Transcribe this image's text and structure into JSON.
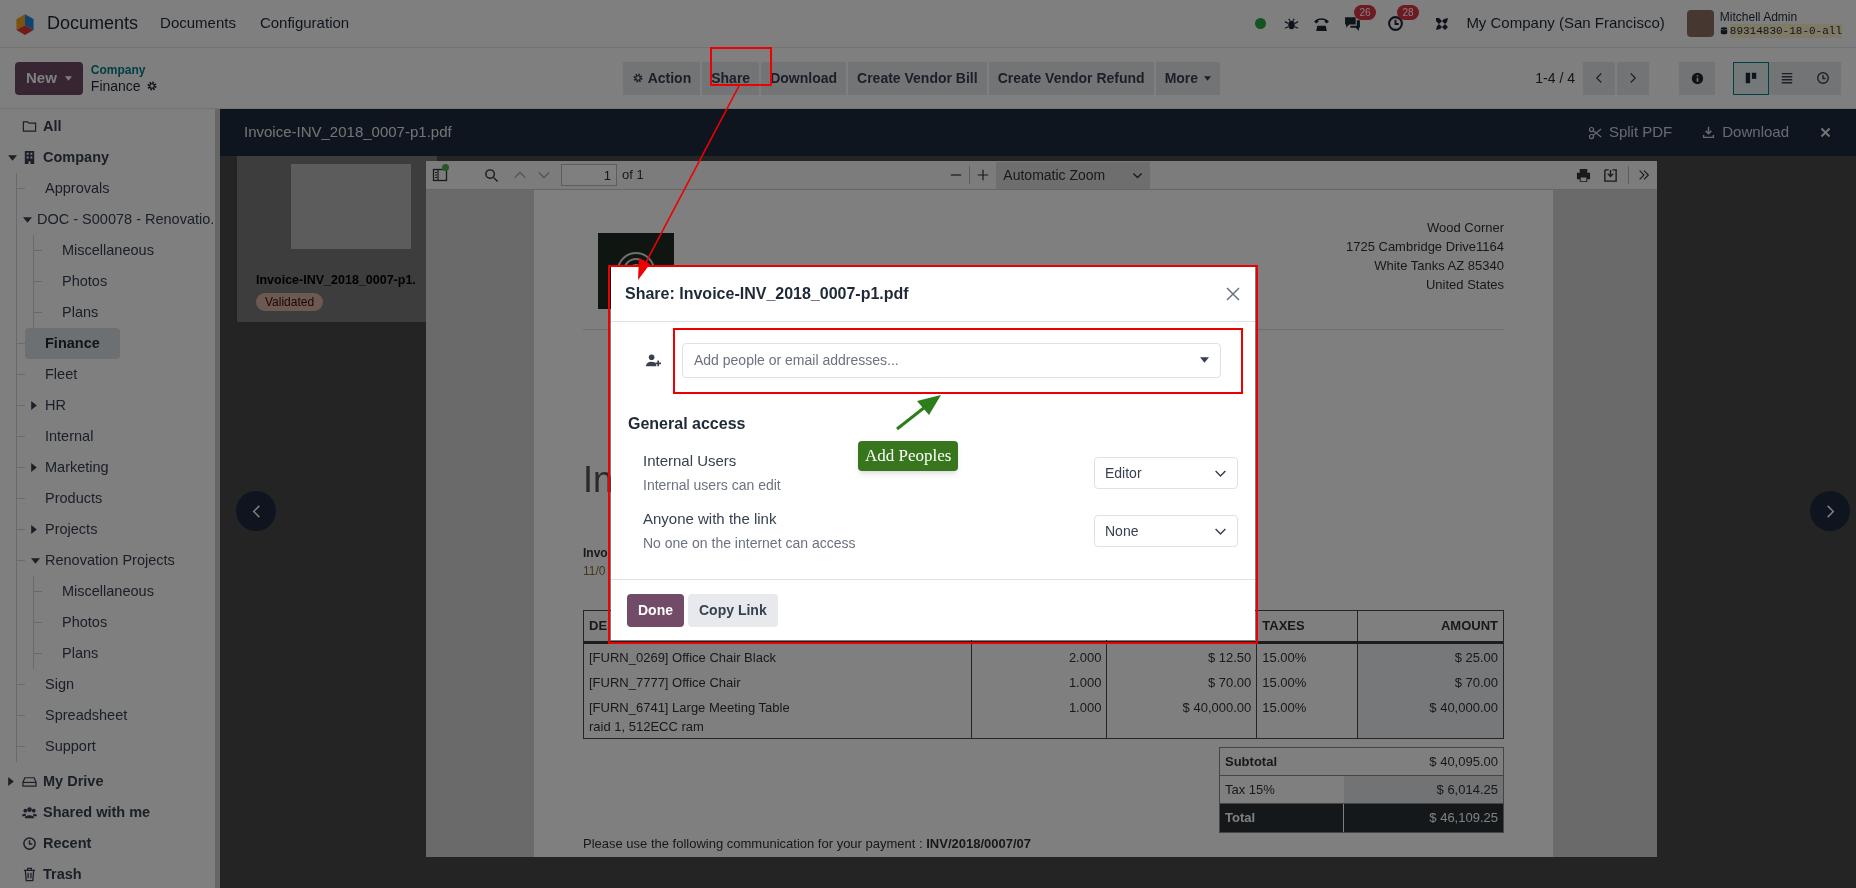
{
  "navbar": {
    "app": "Documents",
    "menu": [
      "Documents",
      "Configuration"
    ],
    "messages_badge": "26",
    "activities_badge": "28",
    "company": "My Company (San Francisco)",
    "user": {
      "name": "Mitchell Admin",
      "database": "89314830-18-0-all"
    }
  },
  "control_panel": {
    "new_button": "New",
    "breadcrumb": {
      "parent": "Company",
      "current": "Finance"
    },
    "actions": [
      {
        "label": "Action",
        "kind": "gear"
      },
      {
        "label": "Share",
        "kind": "plain"
      },
      {
        "label": "Download",
        "kind": "plain"
      },
      {
        "label": "Create Vendor Bill",
        "kind": "plain"
      },
      {
        "label": "Create Vendor Refund",
        "kind": "plain"
      },
      {
        "label": "More",
        "kind": "dropdown"
      }
    ],
    "pager": "1-4 / 4",
    "views": [
      {
        "kind": "kanban",
        "selected": true
      },
      {
        "kind": "list",
        "selected": false
      },
      {
        "kind": "activity",
        "selected": false
      }
    ]
  },
  "sidebar": {
    "items": [
      {
        "label": "All",
        "kind": "folder",
        "selected": false
      },
      {
        "label": "Company",
        "kind": "company",
        "selected": false,
        "expanded": true,
        "children": [
          {
            "label": "Approvals",
            "selected": false
          },
          {
            "label": "DOC - S00078 - Renovatio.",
            "selected": false,
            "expanded": true,
            "children": [
              {
                "label": "Miscellaneous",
                "selected": false
              },
              {
                "label": "Photos",
                "selected": false
              },
              {
                "label": "Plans",
                "selected": false
              }
            ]
          },
          {
            "label": "Finance",
            "selected": true
          },
          {
            "label": "Fleet",
            "selected": false
          },
          {
            "label": "HR",
            "selected": false,
            "expanded": false
          },
          {
            "label": "Internal",
            "selected": false
          },
          {
            "label": "Marketing",
            "selected": false,
            "expanded": false
          },
          {
            "label": "Products",
            "selected": false
          },
          {
            "label": "Projects",
            "selected": false,
            "expanded": false
          },
          {
            "label": "Renovation Projects",
            "selected": false,
            "expanded": true,
            "children": [
              {
                "label": "Miscellaneous",
                "selected": false
              },
              {
                "label": "Photos",
                "selected": false
              },
              {
                "label": "Plans",
                "selected": false
              }
            ]
          },
          {
            "label": "Sign",
            "selected": false
          },
          {
            "label": "Spreadsheet",
            "selected": false
          },
          {
            "label": "Support",
            "selected": false
          }
        ]
      },
      {
        "label": "My Drive",
        "kind": "drive",
        "selected": false,
        "expanded": false
      },
      {
        "label": "Shared with me",
        "kind": "shared",
        "selected": false
      },
      {
        "label": "Recent",
        "kind": "recent",
        "selected": false
      },
      {
        "label": "Trash",
        "kind": "trash",
        "selected": false
      }
    ]
  },
  "viewer": {
    "title": "Invoice-INV_2018_0007-p1.pdf",
    "actions": [
      {
        "label": "Split PDF",
        "kind": "split"
      },
      {
        "label": "Download",
        "kind": "download"
      }
    ],
    "card": {
      "title": "Invoice-INV_2018_0007-p1.",
      "tag": "Validated"
    },
    "pdf_toolbar": {
      "page": "1",
      "page_count": "of 1",
      "zoom": "Automatic Zoom"
    },
    "document": {
      "address": [
        "Wood Corner",
        "1725 Cambridge Drive1164",
        "White Tanks AZ 85340",
        "United States"
      ],
      "heading": "In",
      "label": "Invo",
      "date": "11/0",
      "columns": [
        "DE",
        "",
        "",
        "TAXES",
        "AMOUNT"
      ],
      "rows": [
        {
          "description": [
            "[FURN_0269] Office Chair Black"
          ],
          "quantity": "2.000",
          "price": "$ 12.50",
          "taxes": "15.00%",
          "amount": "$ 25.00"
        },
        {
          "description": [
            "[FURN_7777] Office Chair"
          ],
          "quantity": "1.000",
          "price": "$ 70.00",
          "taxes": "15.00%",
          "amount": "$ 70.00"
        },
        {
          "description": [
            "[FURN_6741] Large Meeting Table",
            "raid 1, 512ECC ram"
          ],
          "quantity": "1.000",
          "price": "$ 40,000.00",
          "taxes": "15.00%",
          "amount": "$ 40,000.00"
        }
      ],
      "totals": [
        {
          "label": "Subtotal",
          "value": "$ 40,095.00",
          "kind": "subtotal"
        },
        {
          "label": "Tax 15%",
          "value": "$ 6,014.25",
          "kind": "tax"
        },
        {
          "label": "Total",
          "value": "$ 46,109.25",
          "kind": "total"
        }
      ],
      "footer": "Please use the following communication for your payment : **INV/2018/0007/07**"
    }
  },
  "dialog": {
    "title": "Share: Invoice-INV_2018_0007-p1.pdf",
    "placeholder": "Add people or email addresses...",
    "section": "General access",
    "access": [
      {
        "label": "Internal Users",
        "description": "Internal users can edit",
        "value": "Editor"
      },
      {
        "label": "Anyone with the link",
        "description": "No one on the internet can access",
        "value": "None"
      }
    ],
    "buttons": [
      {
        "label": "Done",
        "kind": "primary"
      },
      {
        "label": "Copy Link",
        "kind": "secondary"
      }
    ]
  },
  "callout": {
    "text": "Add Peoples"
  }
}
